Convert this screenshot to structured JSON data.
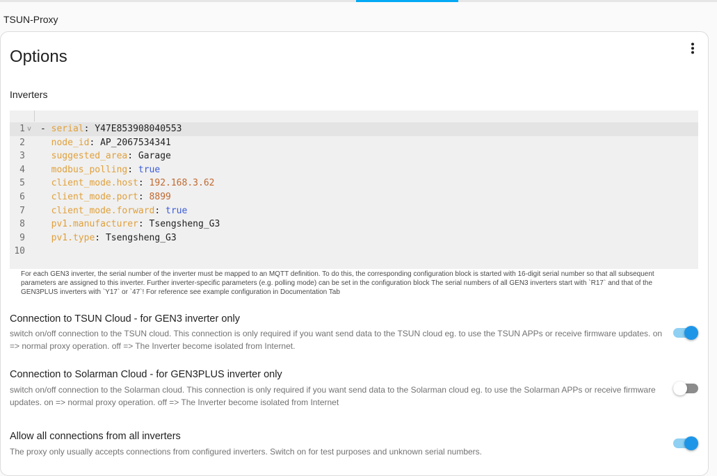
{
  "header": {
    "app_title": "TSUN-Proxy"
  },
  "card": {
    "title": "Options",
    "more_icon": "dots-vertical-icon"
  },
  "inverters": {
    "label": "Inverters",
    "code_lines": [
      {
        "num": "1",
        "fold": "v",
        "indent": "",
        "dash": "- ",
        "key": "serial",
        "value": "Y47E853908040553",
        "value_type": "s"
      },
      {
        "num": "2",
        "fold": "",
        "indent": "  ",
        "dash": "",
        "key": "node_id",
        "value": "AP_2067534341",
        "value_type": "s"
      },
      {
        "num": "3",
        "fold": "",
        "indent": "  ",
        "dash": "",
        "key": "suggested_area",
        "value": "Garage",
        "value_type": "s"
      },
      {
        "num": "4",
        "fold": "",
        "indent": "  ",
        "dash": "",
        "key": "modbus_polling",
        "value": "true",
        "value_type": "b"
      },
      {
        "num": "5",
        "fold": "",
        "indent": "  ",
        "dash": "",
        "key": "client_mode.host",
        "value": "192.168.3.62",
        "value_type": "n"
      },
      {
        "num": "6",
        "fold": "",
        "indent": "  ",
        "dash": "",
        "key": "client_mode.port",
        "value": "8899",
        "value_type": "n"
      },
      {
        "num": "7",
        "fold": "",
        "indent": "  ",
        "dash": "",
        "key": "client_mode.forward",
        "value": "true",
        "value_type": "b"
      },
      {
        "num": "8",
        "fold": "",
        "indent": "  ",
        "dash": "",
        "key": "pv1.manufacturer",
        "value": "Tsengsheng_G3",
        "value_type": "s"
      },
      {
        "num": "9",
        "fold": "",
        "indent": "  ",
        "dash": "",
        "key": "pv1.type",
        "value": "Tsengsheng_G3",
        "value_type": "s"
      },
      {
        "num": "10",
        "fold": "",
        "indent": "",
        "dash": "",
        "key": "",
        "value": "",
        "value_type": "s"
      }
    ],
    "help_text": "For each GEN3 inverter, the serial number of the inverter must be mapped to an MQTT definition. To do this, the corresponding configuration block is started with 16-digit serial number so that all subsequent parameters are assigned to this inverter. Further inverter-specific parameters (e.g. polling mode) can be set in the configuration block The serial numbers of all GEN3 inverters start with `R17` and that of the GEN3PLUS inverters with `Y17` or `47`! For reference see example configuration in Documentation Tab"
  },
  "options": [
    {
      "title": "Connection to TSUN Cloud - for GEN3 inverter only",
      "description": "switch on/off connection to the TSUN cloud. This connection is only required if you want send data to the TSUN cloud eg. to use the TSUN APPs or receive firmware updates. on => normal proxy operation. off => The Inverter become isolated from Internet.",
      "enabled": true
    },
    {
      "title": "Connection to Solarman Cloud - for GEN3PLUS inverter only",
      "description": "switch on/off connection to the Solarman cloud. This connection is only required if you want send data to the Solarman cloud eg. to use the Solarman APPs or receive firmware updates. on => normal proxy operation. off => The Inverter become isolated from Internet",
      "enabled": false
    },
    {
      "title": "Allow all connections from all inverters",
      "description": "The proxy only usually accepts connections from configured inverters. Switch on for test purposes and unknown serial numbers.",
      "enabled": true
    }
  ],
  "colors": {
    "accent": "#03a9f4",
    "toggle_on": "#1e96e8",
    "yaml_key": "#e0a03c",
    "yaml_number": "#c0692f",
    "yaml_bool": "#3b5bd8"
  }
}
